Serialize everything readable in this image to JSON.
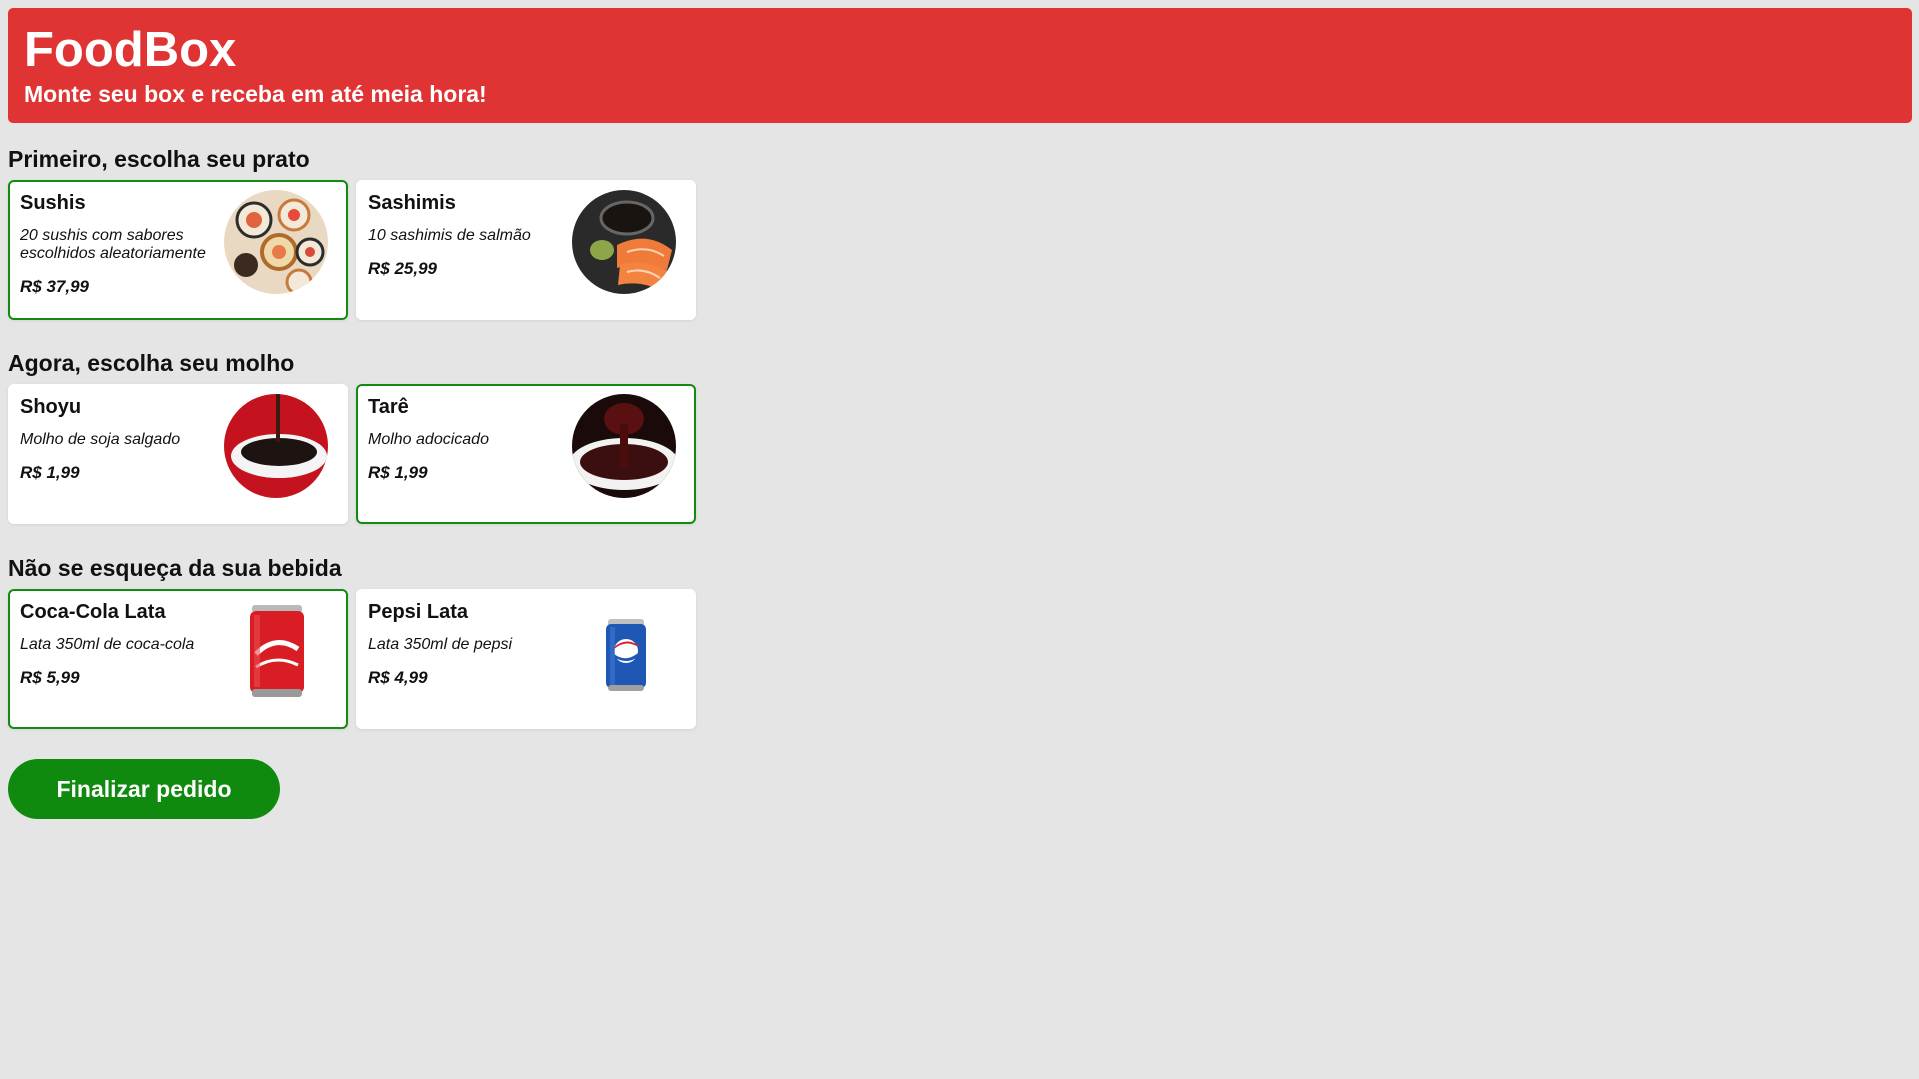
{
  "header": {
    "title": "FoodBox",
    "subtitle": "Monte seu box e receba em até meia hora!"
  },
  "colors": {
    "header_bg": "#e03434",
    "page_bg": "#e5e5e5",
    "selected_border": "#118b11",
    "button_bg": "#0f8a0f"
  },
  "sections": [
    {
      "title": "Primeiro, escolha seu prato",
      "items": [
        {
          "name": "Sushis",
          "description": "20 sushis com sabores escolhidos aleatoriamente",
          "price": "R$ 37,99",
          "image": "sushi-image",
          "selected": true
        },
        {
          "name": "Sashimis",
          "description": "10 sashimis de salmão",
          "price": "R$ 25,99",
          "image": "sashimi-image",
          "selected": false
        }
      ]
    },
    {
      "title": "Agora, escolha seu molho",
      "items": [
        {
          "name": "Shoyu",
          "description": "Molho de soja salgado",
          "price": "R$ 1,99",
          "image": "shoyu-image",
          "selected": false
        },
        {
          "name": "Tarê",
          "description": "Molho adocicado",
          "price": "R$ 1,99",
          "image": "tare-image",
          "selected": true
        }
      ]
    },
    {
      "title": "Não se esqueça da sua bebida",
      "items": [
        {
          "name": "Coca-Cola Lata",
          "description": "Lata 350ml de coca-cola",
          "price": "R$ 5,99",
          "image": "coca-cola-can-image",
          "selected": true
        },
        {
          "name": "Pepsi Lata",
          "description": "Lata 350ml de pepsi",
          "price": "R$ 4,99",
          "image": "pepsi-can-image",
          "selected": false
        }
      ]
    }
  ],
  "finish_button": {
    "label": "Finalizar pedido"
  }
}
